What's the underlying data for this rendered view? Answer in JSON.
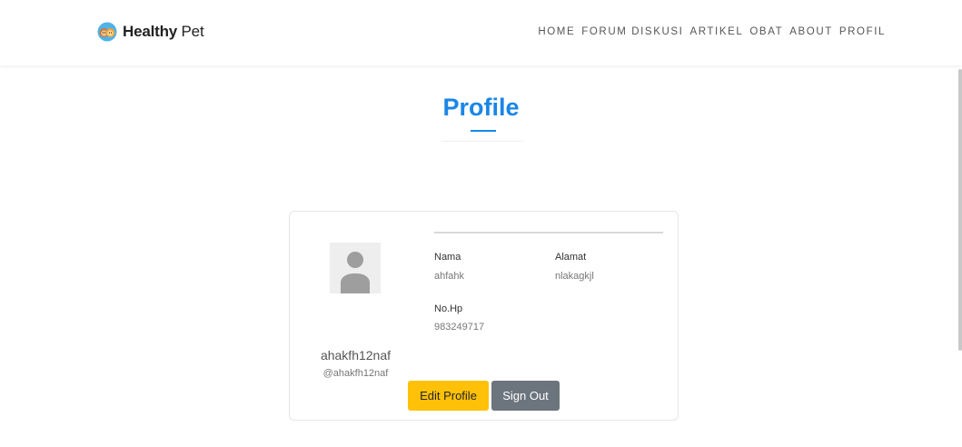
{
  "brand": {
    "bold": "Healthy",
    "light": "Pet"
  },
  "nav": [
    "HOME",
    "FORUM DISKUSI",
    "ARTIKEL",
    "OBAT",
    "ABOUT",
    "PROFIL"
  ],
  "page": {
    "title": "Profile"
  },
  "profile": {
    "username": "ahakfh12naf",
    "handle": "@ahakfh12naf",
    "fields": {
      "nama_label": "Nama",
      "nama_value": "ahfahk",
      "alamat_label": "Alamat",
      "alamat_value": "nlakagkjl",
      "hp_label": "No.Hp",
      "hp_value": "983249717"
    }
  },
  "actions": {
    "edit": "Edit Profile",
    "signout": "Sign Out"
  },
  "colors": {
    "accent": "#1a86e6",
    "edit_button": "#ffc107",
    "signout_button": "#6c757d"
  }
}
